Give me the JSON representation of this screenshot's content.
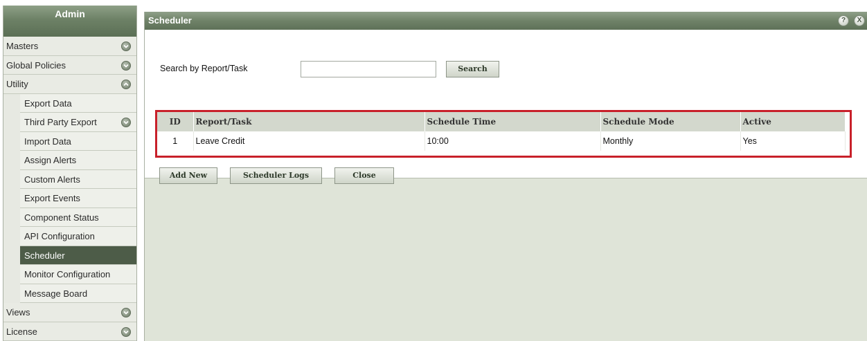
{
  "sidebar": {
    "title": "Admin",
    "items": [
      {
        "label": "Masters"
      },
      {
        "label": "Global Policies"
      },
      {
        "label": "Utility"
      },
      {
        "label": "Export Data"
      },
      {
        "label": "Third Party Export"
      },
      {
        "label": "Import Data"
      },
      {
        "label": "Assign Alerts"
      },
      {
        "label": "Custom Alerts"
      },
      {
        "label": "Export Events"
      },
      {
        "label": "Component Status"
      },
      {
        "label": "API Configuration"
      },
      {
        "label": "Scheduler"
      },
      {
        "label": "Monitor Configuration"
      },
      {
        "label": "Message Board"
      },
      {
        "label": "Views"
      },
      {
        "label": "License"
      }
    ]
  },
  "panel": {
    "title": "Scheduler",
    "help_glyph": "?",
    "close_glyph": "X"
  },
  "search": {
    "label": "Search by Report/Task",
    "value": "",
    "button": "Search"
  },
  "table": {
    "headers": [
      "ID",
      "Report/Task",
      "Schedule Time",
      "Schedule Mode",
      "Active"
    ],
    "rows": [
      [
        "1",
        "Leave Credit",
        "10:00",
        "Monthly",
        "Yes"
      ]
    ]
  },
  "actions": {
    "add_new": "Add New",
    "scheduler_logs": "Scheduler Logs",
    "close": "Close"
  },
  "colors": {
    "header_green": "#6d8166",
    "active_item": "#4d5c48",
    "highlight_red": "#c8202a"
  }
}
